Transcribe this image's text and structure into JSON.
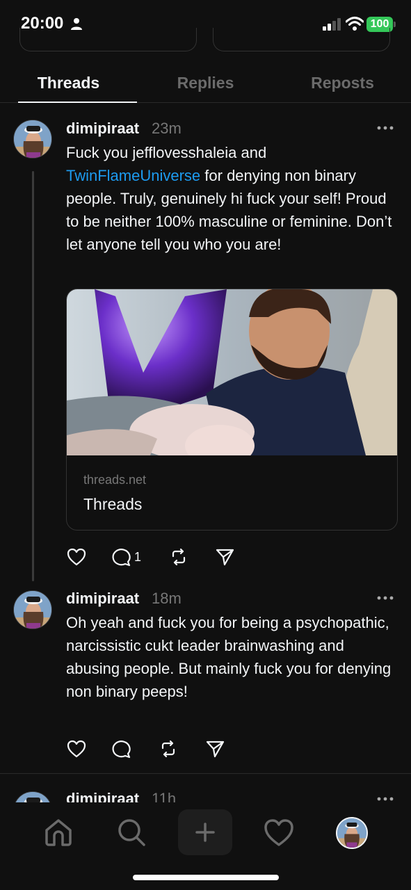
{
  "status_bar": {
    "time": "20:00",
    "battery": "100"
  },
  "tabs": [
    {
      "label": "Threads",
      "active": true
    },
    {
      "label": "Replies",
      "active": false
    },
    {
      "label": "Reposts",
      "active": false
    }
  ],
  "posts": [
    {
      "username": "dimipiraat",
      "time": "23m",
      "text_parts": {
        "before": "Fuck you jefflovesshaleia and ",
        "mention": "TwinFlameUniverse",
        "after": " for denying non binary people. Truly, genuinely hi fuck your self! Proud to be neither 100% masculine or feminine. Don’t let anyone tell you who you are!"
      },
      "link_card": {
        "domain": "threads.net",
        "title": "Threads"
      },
      "reply_count": "1"
    },
    {
      "username": "dimipiraat",
      "time": "18m",
      "text": "Oh yeah and fuck you for being a psychopathic, narcissistic cukt leader brainwashing and abusing people. But mainly fuck you for denying non binary peeps!",
      "reply_count": ""
    },
    {
      "username": "dimipiraat",
      "time": "11h"
    }
  ],
  "colors": {
    "background": "#101010",
    "mention": "#1d9bf0",
    "battery": "#34c759"
  },
  "icons": [
    "person-icon",
    "signal-icon",
    "wifi-icon",
    "heart-icon",
    "comment-icon",
    "repost-icon",
    "share-icon",
    "more-icon",
    "home-icon",
    "search-icon",
    "plus-icon",
    "activity-heart-icon"
  ]
}
